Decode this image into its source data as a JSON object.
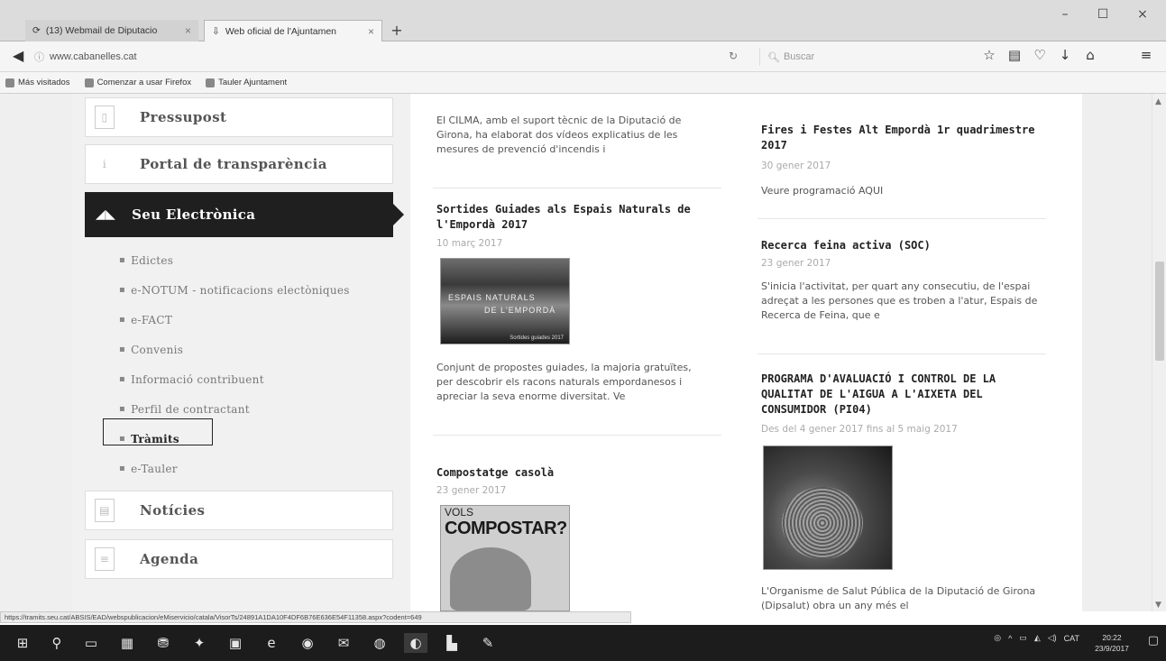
{
  "browser": {
    "tabs": [
      {
        "title": "(13) Webmail de Diputacio",
        "close": "×"
      },
      {
        "title": "Web oficial de l'Ajuntamen",
        "close": "×"
      }
    ],
    "new_tab": "+",
    "window_controls": {
      "minimize": "–",
      "maximize": "☐",
      "close": "×"
    },
    "url": "www.cabanelles.cat",
    "search_placeholder": "Buscar",
    "bookmarks": [
      "Más visitados",
      "Comenzar a usar Firefox",
      "Tauler Ajuntament"
    ],
    "status_url": "https://tramits.seu.cat/ABSIS/EAD/webspublicacion/eMiservicio/catala/VisorTs/24891A1DA10F4DF6B76E636E54F11358.aspx?codent=649"
  },
  "sidebar": {
    "top_items": [
      "Pressupost",
      "Portal de transparència"
    ],
    "active": "Seu Electrònica",
    "bullet": "▪",
    "submenu": [
      "Edictes",
      "e-NOTUM - notificacions electòniques",
      "e-FACT",
      "Convenis",
      "Informació contribuent",
      "Perfil de contractant",
      "Tràmits",
      "e-Tauler"
    ],
    "bottom_items": [
      "Notícies",
      "Agenda"
    ]
  },
  "middle": {
    "intro": "El CILMA, amb el suport tècnic de la Diputació de Girona, ha elaborat dos vídeos explicatius de les mesures de prevenció d'incendis i",
    "articles": [
      {
        "title": "Sortides Guiades als Espais Naturals de l'Empordà 2017",
        "date": "10 març 2017",
        "thumb_text1": "ESPAIS NATURALS",
        "thumb_text2": "DE L'EMPORDÀ",
        "thumb_text3": "Sortides guiades 2017",
        "excerpt": "Conjunt de propostes guiades, la majoria gratuïtes, per descobrir els racons naturals empordanesos i apreciar la seva enorme diversitat. Ve"
      },
      {
        "title": "Compostatge casolà",
        "date": "23 gener 2017",
        "thumb_text1": "VOLS",
        "thumb_text2": "COMPOSTAR?"
      }
    ]
  },
  "right": {
    "articles": [
      {
        "title": "Fires i Festes Alt Empordà 1r quadrimestre 2017",
        "date": "30 gener 2017",
        "excerpt": "Veure programació AQUI"
      },
      {
        "title": "Recerca feina activa (SOC)",
        "date": "23 gener 2017",
        "excerpt": "S'inicia l'activitat, per quart any consecutiu, de l'espai adreçat a les persones que es troben a l'atur, Espais de Recerca de Feina, que e"
      },
      {
        "title": "PROGRAMA D'AVALUACIÓ I CONTROL DE LA QUALITAT DE L'AIGUA A L'AIXETA DEL CONSUMIDOR (PI04)",
        "date": "Des del 4 gener 2017 fins al 5 maig 2017",
        "excerpt": "L'Organisme de Salut Pública de la Diputació de Girona (Dipsalut) obra un any més el"
      }
    ]
  },
  "taskbar": {
    "tray_lang": "CAT",
    "time": "20:22",
    "date": "23/9/2017"
  },
  "colors": {
    "active_menu_bg": "#1f1f1f",
    "sidebar_bg": "#f1f1f1",
    "taskbar_bg": "#1c1c1c"
  }
}
